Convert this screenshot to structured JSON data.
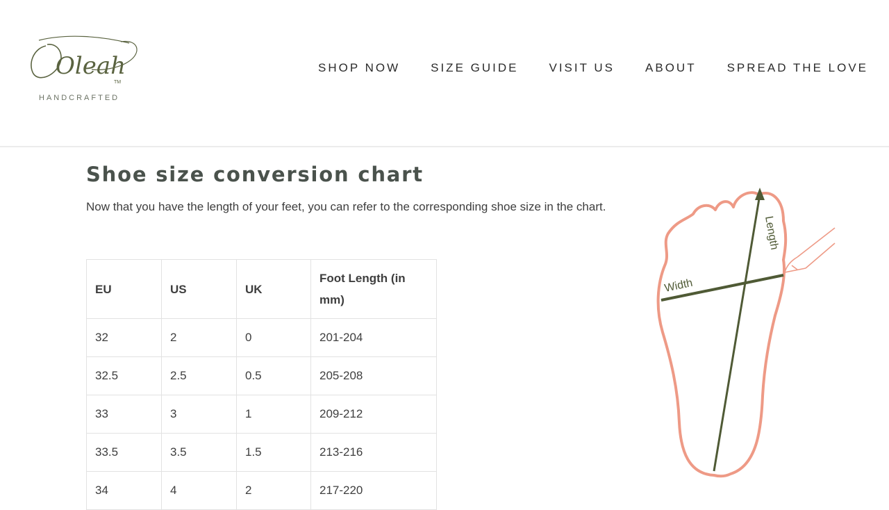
{
  "brand": {
    "logo_script": "Oleah",
    "logo_tm": "TM",
    "logo_sub": "HANDCRAFTED"
  },
  "nav": {
    "items": [
      {
        "label": "SHOP NOW"
      },
      {
        "label": "SIZE GUIDE"
      },
      {
        "label": "VISIT US"
      },
      {
        "label": "ABOUT"
      },
      {
        "label": "SPREAD THE LOVE"
      }
    ]
  },
  "page": {
    "title": "Shoe size conversion chart",
    "intro": "Now that you have the length of your feet, you can refer to the corresponding shoe size in the chart."
  },
  "table": {
    "headers": [
      "EU",
      "US",
      "UK",
      "Foot Length (in mm)"
    ],
    "rows": [
      [
        "32",
        "2",
        "0",
        "201-204"
      ],
      [
        "32.5",
        "2.5",
        "0.5",
        "205-208"
      ],
      [
        "33",
        "3",
        "1",
        "209-212"
      ],
      [
        "33.5",
        "3.5",
        "1.5",
        "213-216"
      ],
      [
        "34",
        "4",
        "2",
        "217-220"
      ]
    ]
  },
  "illustration": {
    "width_label": "Width",
    "length_label": "Length"
  },
  "colors": {
    "foot_outline": "#ee9a86",
    "measure_line": "#4f5a35",
    "logo": "#5a6340"
  }
}
